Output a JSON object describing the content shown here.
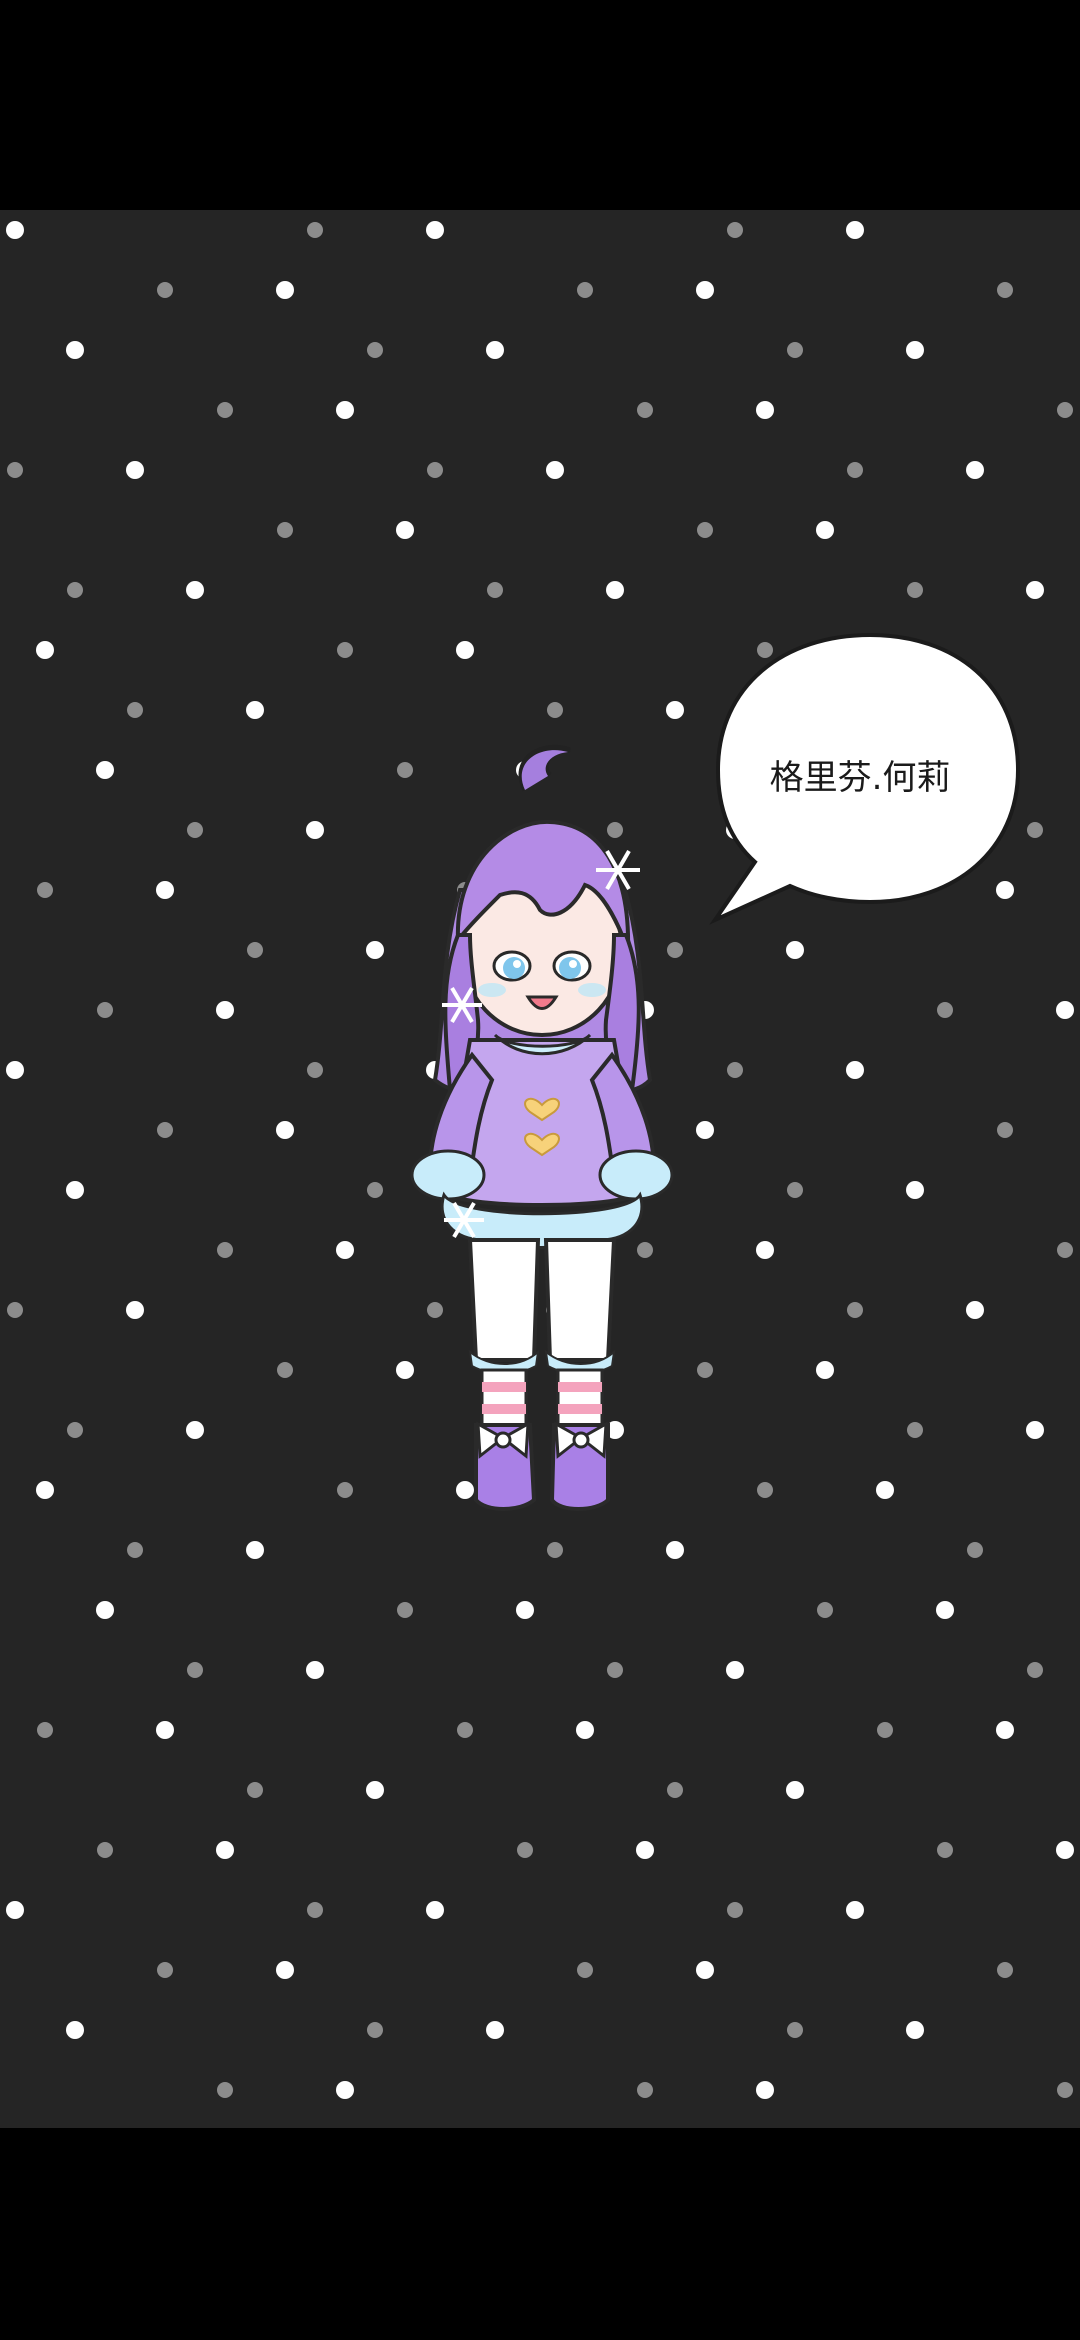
{
  "scene": {
    "background_color": "#252525",
    "letterbox_color": "#000000",
    "snow_colors": [
      "#ffffff",
      "#8a8a8a"
    ]
  },
  "speech_bubble": {
    "text": "格里芬.何莉"
  },
  "character": {
    "hair_color": "#b48be6",
    "outfit_color": "#c4a6ee",
    "trim_color": "#c8ecfa"
  }
}
